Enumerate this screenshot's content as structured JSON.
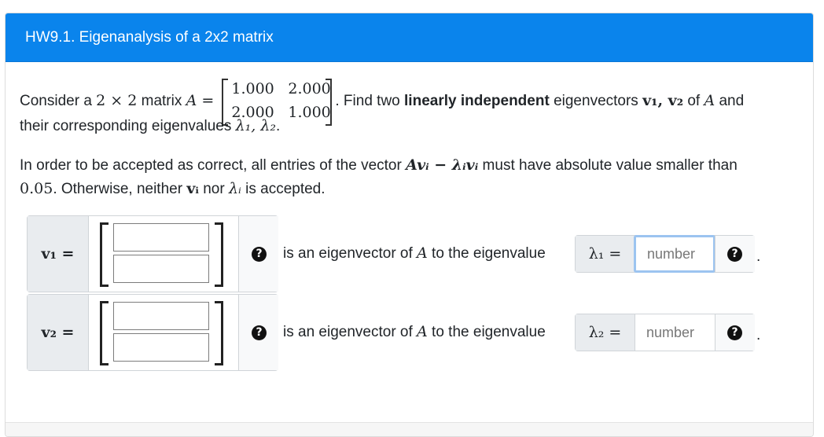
{
  "header": {
    "title": "HW9.1. Eigenanalysis of a 2x2 matrix"
  },
  "problem": {
    "consider": "Consider a ",
    "dims": "2 × 2",
    "matrix_word": " matrix ",
    "matrix_name": "A",
    "equals": " = ",
    "matrix": [
      [
        "1.000",
        "2.000"
      ],
      [
        "2.000",
        "1.000"
      ]
    ],
    "find_two": ". Find two ",
    "lin_indep": "linearly independent",
    "eigenvectors_word": " eigenvectors ",
    "v1v2": "v₁, v₂",
    "of": " of ",
    "and": " and",
    "their_corr": "their corresponding eigenvalues ",
    "lambdas": "λ₁, λ₂",
    "period": ".",
    "accept_pre": "In order to be accepted as correct, all entries of the vector ",
    "accept_expr": "Avᵢ − λᵢvᵢ",
    "accept_post": " must have absolute value smaller than",
    "tolerance": "0.05",
    "otherwise": ". Otherwise, neither ",
    "vi": "vᵢ",
    "nor": " nor ",
    "lambda_i": "λᵢ",
    "is_accepted": " is accepted."
  },
  "answers": [
    {
      "vec_label": "v₁ =",
      "vec_inputs": [
        "",
        ""
      ],
      "eig_text_pre": "is an eigenvector of ",
      "eig_text_A": "A",
      "eig_text_post": " to the eigenvalue",
      "lambda_label": "λ₁ =",
      "lambda_value": "",
      "lambda_placeholder": "number",
      "help_glyph": "?",
      "trailing": "."
    },
    {
      "vec_label": "v₂ =",
      "vec_inputs": [
        "",
        ""
      ],
      "eig_text_pre": "is an eigenvector of ",
      "eig_text_A": "A",
      "eig_text_post": " to the eigenvalue",
      "lambda_label": "λ₂ =",
      "lambda_value": "",
      "lambda_placeholder": "number",
      "help_glyph": "?",
      "trailing": "."
    }
  ],
  "colors": {
    "header_bg": "#0a84ec",
    "focus_ring": "#9cc4f0"
  }
}
